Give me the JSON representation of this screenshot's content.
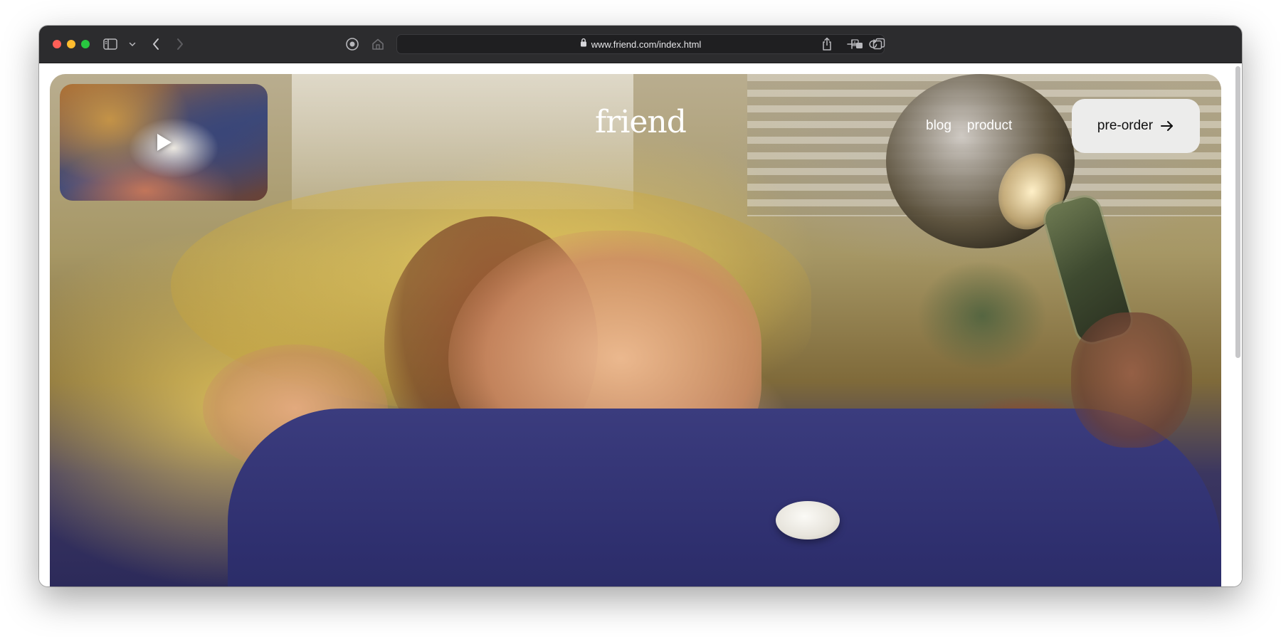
{
  "browser": {
    "url": "www.friend.com/index.html",
    "icons": {
      "sidebar": "sidebar-icon",
      "back": "chevron-left-icon",
      "forward": "chevron-right-icon",
      "privacy": "privacy-report-icon",
      "home": "home-icon",
      "lock": "lock-icon",
      "translate": "translate-icon",
      "reload": "reload-icon",
      "share": "share-icon",
      "new_tab": "plus-icon",
      "tabs": "tab-overview-icon"
    }
  },
  "page": {
    "logo": "friend",
    "nav": [
      {
        "label": "blog"
      },
      {
        "label": "product"
      }
    ],
    "cta": {
      "label": "pre-order",
      "icon": "arrow-right-icon"
    },
    "video": {
      "icon": "play-icon"
    }
  },
  "colors": {
    "titlebar": "#2c2c2e",
    "cta_background": "#ececeb",
    "text_on_hero": "#ffffff"
  }
}
